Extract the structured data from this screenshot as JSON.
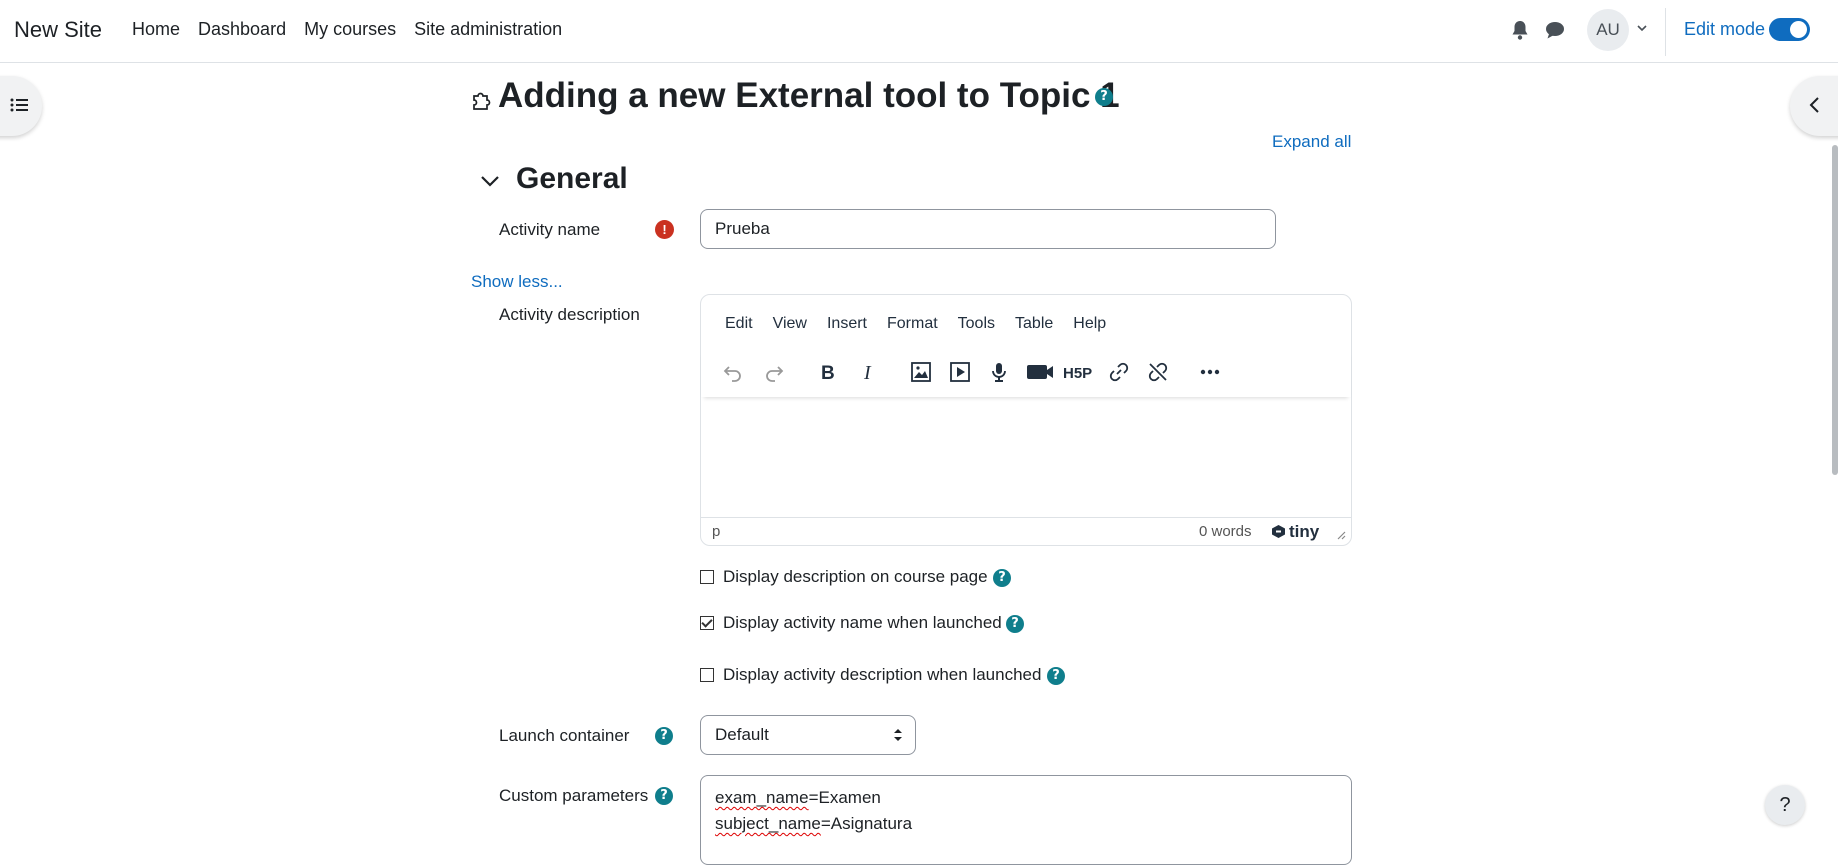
{
  "navbar": {
    "brand": "New Site",
    "links": [
      "Home",
      "Dashboard",
      "My courses",
      "Site administration"
    ],
    "avatar_initials": "AU",
    "edit_mode_label": "Edit mode",
    "edit_mode_on": true
  },
  "page": {
    "title": "Adding a new External tool to Topic 1",
    "expand_all": "Expand all",
    "section_title": "General"
  },
  "form": {
    "activity_name_label": "Activity name",
    "activity_name_value": "Prueba",
    "show_less": "Show less...",
    "activity_description_label": "Activity description",
    "editor": {
      "menus": [
        "Edit",
        "View",
        "Insert",
        "Format",
        "Tools",
        "Table",
        "Help"
      ],
      "status_path": "p",
      "word_count": "0 words",
      "brand": "tiny"
    },
    "checkboxes": [
      {
        "label": "Display description on course page",
        "checked": false
      },
      {
        "label": "Display activity name when launched",
        "checked": true
      },
      {
        "label": "Display activity description when launched",
        "checked": false
      }
    ],
    "launch_container_label": "Launch container",
    "launch_container_value": "Default",
    "custom_parameters_label": "Custom parameters",
    "custom_parameters_lines": [
      {
        "key": "exam_name",
        "value": "=Examen"
      },
      {
        "key": "subject_name",
        "value": "=Asignatura"
      }
    ]
  },
  "help_fab": "?",
  "colors": {
    "accent": "#0f6cbf",
    "help": "#0f7e8c",
    "required": "#ca3120"
  }
}
